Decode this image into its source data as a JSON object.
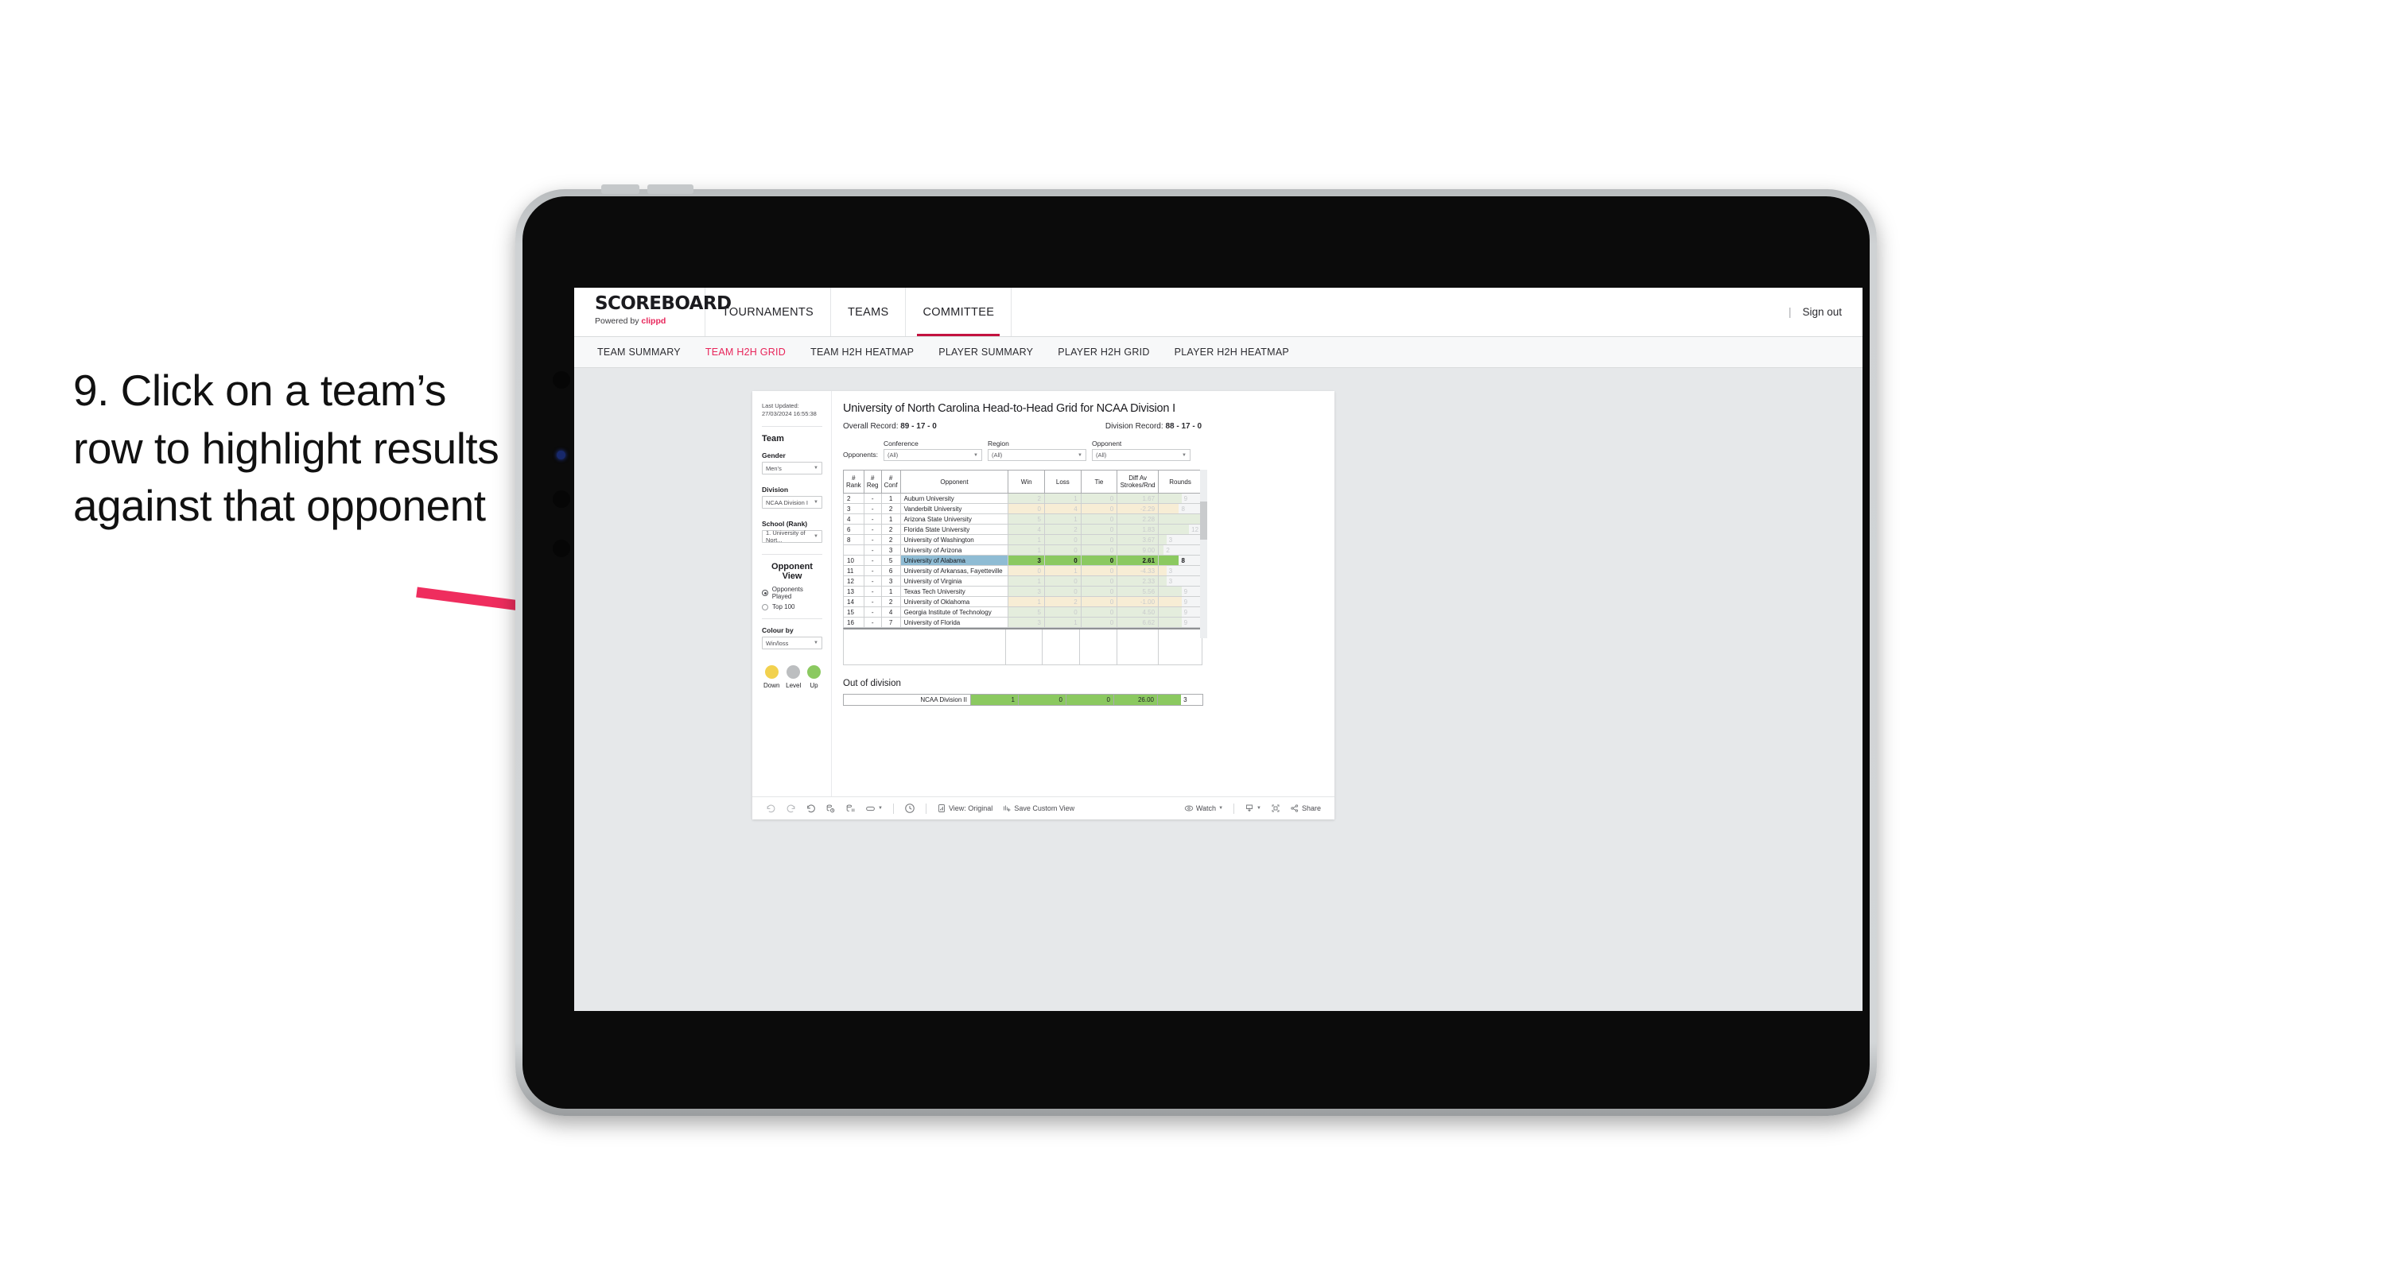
{
  "annotation": {
    "text": "9. Click on a team’s row to highlight results against that opponent",
    "arrow_color": "#ef2d5e"
  },
  "app": {
    "brand": {
      "name": "SCOREBOARD",
      "powered_prefix": "Powered by ",
      "powered_brand": "clippd"
    },
    "top_nav": [
      {
        "label": "TOURNAMENTS",
        "active": false
      },
      {
        "label": "TEAMS",
        "active": false
      },
      {
        "label": "COMMITTEE",
        "active": true
      }
    ],
    "sign_out": "Sign out",
    "sign_out_separator": "|",
    "sub_nav": [
      {
        "label": "TEAM SUMMARY",
        "active": false
      },
      {
        "label": "TEAM H2H GRID",
        "active": true
      },
      {
        "label": "TEAM H2H HEATMAP",
        "active": false
      },
      {
        "label": "PLAYER SUMMARY",
        "active": false
      },
      {
        "label": "PLAYER H2H GRID",
        "active": false
      },
      {
        "label": "PLAYER H2H HEATMAP",
        "active": false
      }
    ],
    "accent_color": "#e8255a"
  },
  "sidebar": {
    "last_updated": "Last Updated: 27/03/2024 16:55:38",
    "team_heading": "Team",
    "gender": {
      "label": "Gender",
      "value": "Men’s"
    },
    "division": {
      "label": "Division",
      "value": "NCAA Division I"
    },
    "school": {
      "label": "School (Rank)",
      "value": "1. University of Nort..."
    },
    "opponent_view": {
      "heading": "Opponent View",
      "options": [
        {
          "label": "Opponents Played",
          "selected": true
        },
        {
          "label": "Top 100",
          "selected": false
        }
      ]
    },
    "colour_by": {
      "label": "Colour by",
      "value": "Win/loss"
    },
    "legend": [
      {
        "label": "Down",
        "color": "#f2d14e"
      },
      {
        "label": "Level",
        "color": "#bcbec0"
      },
      {
        "label": "Up",
        "color": "#8bc960"
      }
    ]
  },
  "viz": {
    "title": "University of North Carolina Head-to-Head Grid for NCAA Division I",
    "overall_record_label": "Overall Record:",
    "overall_record_value": "89 - 17 - 0",
    "division_record_label": "Division Record:",
    "division_record_value": "88 - 17 - 0",
    "filters_prefix": "Opponents:",
    "filters": [
      {
        "label": "Conference",
        "value": "(All)"
      },
      {
        "label": "Region",
        "value": "(All)"
      },
      {
        "label": "Opponent",
        "value": "(All)"
      }
    ],
    "columns": [
      "# Rank",
      "# Reg",
      "# Conf",
      "Opponent",
      "Win",
      "Loss",
      "Tie",
      "Diff Av Strokes/Rnd",
      "Rounds"
    ],
    "column_headers": {
      "rank_top": "#",
      "rank_bot": "Rank",
      "reg_top": "#",
      "reg_bot": "Reg",
      "conf_top": "#",
      "conf_bot": "Conf",
      "opponent": "Opponent",
      "win": "Win",
      "loss": "Loss",
      "tie": "Tie",
      "diff_top": "Diff Av",
      "diff_bot": "Strokes/Rnd",
      "rounds": "Rounds"
    },
    "rows": [
      {
        "rank": "2",
        "reg": "-",
        "conf": "1",
        "opponent": "Auburn University",
        "win": "2",
        "loss": "1",
        "tie": "0",
        "diff": "1.67",
        "rounds": "9",
        "tone": "up",
        "selected": false
      },
      {
        "rank": "3",
        "reg": "-",
        "conf": "2",
        "opponent": "Vanderbilt University",
        "win": "0",
        "loss": "4",
        "tie": "0",
        "diff": "-2.29",
        "rounds": "8",
        "tone": "down",
        "selected": false
      },
      {
        "rank": "4",
        "reg": "-",
        "conf": "1",
        "opponent": "Arizona State University",
        "win": "5",
        "loss": "1",
        "tie": "0",
        "diff": "2.28",
        "rounds": "17",
        "tone": "up",
        "selected": false
      },
      {
        "rank": "6",
        "reg": "-",
        "conf": "2",
        "opponent": "Florida State University",
        "win": "4",
        "loss": "2",
        "tie": "0",
        "diff": "1.83",
        "rounds": "12",
        "tone": "up",
        "selected": false
      },
      {
        "rank": "8",
        "reg": "-",
        "conf": "2",
        "opponent": "University of Washington",
        "win": "1",
        "loss": "0",
        "tie": "0",
        "diff": "3.67",
        "rounds": "3",
        "tone": "up",
        "selected": false
      },
      {
        "rank": "",
        "reg": "-",
        "conf": "3",
        "opponent": "University of Arizona",
        "win": "1",
        "loss": "0",
        "tie": "0",
        "diff": "9.00",
        "rounds": "2",
        "tone": "up",
        "selected": false
      },
      {
        "rank": "10",
        "reg": "-",
        "conf": "5",
        "opponent": "University of Alabama",
        "win": "3",
        "loss": "0",
        "tie": "0",
        "diff": "2.61",
        "rounds": "8",
        "tone": "up-bold",
        "selected": true
      },
      {
        "rank": "11",
        "reg": "-",
        "conf": "6",
        "opponent": "University of Arkansas, Fayetteville",
        "win": "0",
        "loss": "1",
        "tie": "0",
        "diff": "-4.33",
        "rounds": "3",
        "tone": "down",
        "selected": false
      },
      {
        "rank": "12",
        "reg": "-",
        "conf": "3",
        "opponent": "University of Virginia",
        "win": "1",
        "loss": "0",
        "tie": "0",
        "diff": "2.33",
        "rounds": "3",
        "tone": "up",
        "selected": false
      },
      {
        "rank": "13",
        "reg": "-",
        "conf": "1",
        "opponent": "Texas Tech University",
        "win": "3",
        "loss": "0",
        "tie": "0",
        "diff": "5.56",
        "rounds": "9",
        "tone": "up",
        "selected": false
      },
      {
        "rank": "14",
        "reg": "-",
        "conf": "2",
        "opponent": "University of Oklahoma",
        "win": "1",
        "loss": "2",
        "tie": "0",
        "diff": "-1.00",
        "rounds": "9",
        "tone": "down",
        "selected": false
      },
      {
        "rank": "15",
        "reg": "-",
        "conf": "4",
        "opponent": "Georgia Institute of Technology",
        "win": "5",
        "loss": "0",
        "tie": "0",
        "diff": "4.50",
        "rounds": "9",
        "tone": "up",
        "selected": false
      },
      {
        "rank": "16",
        "reg": "-",
        "conf": "7",
        "opponent": "University of Florida",
        "win": "3",
        "loss": "1",
        "tie": "0",
        "diff": "6.62",
        "rounds": "9",
        "tone": "up",
        "selected": false
      }
    ],
    "out_of_division": {
      "title": "Out of division",
      "row": {
        "label": "NCAA Division II",
        "win": "1",
        "loss": "0",
        "tie": "0",
        "diff": "26.00",
        "rounds": "3"
      }
    },
    "colors": {
      "up_fill": "#e4eddd",
      "down_fill": "#f7edd5",
      "selected_row": "#8fbcd4",
      "selected_fill": "#8bc960",
      "bar_track": "#f4f5f6"
    }
  },
  "toolbar": {
    "undo": "undo-icon",
    "redo": "redo-icon",
    "revert": "revert-icon",
    "refresh": "refresh-data-icon",
    "pause": "pause-updates-icon",
    "view_original_label": "View: Original",
    "save_custom_view_label": "Save Custom View",
    "watch_label": "Watch",
    "share_label": "Share"
  }
}
